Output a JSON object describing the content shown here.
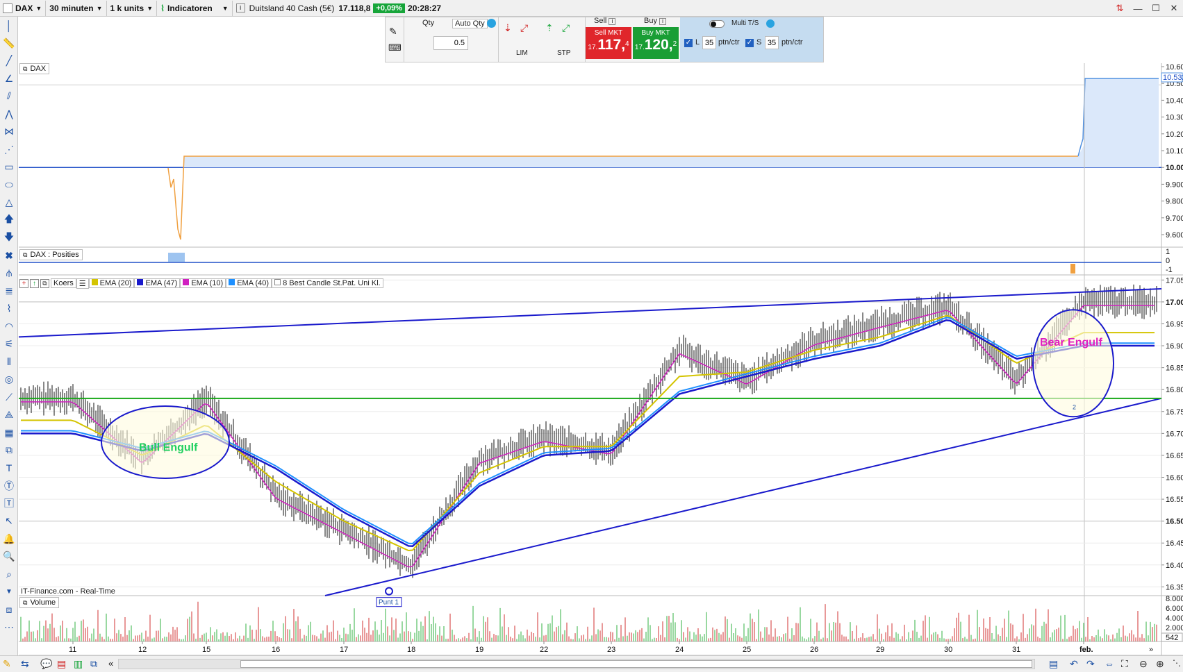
{
  "topbar": {
    "instrument": "DAX",
    "timeframe": "30 minuten",
    "units": "1 k units",
    "indicators_label": "Indicatoren",
    "market_name": "Duitsland 40 Cash (5€)",
    "price": "17.118,8",
    "change": "+0,09%",
    "time": "20:28:27"
  },
  "ticket": {
    "qty_label": "Qty",
    "qty_value": "0.5",
    "auto_qty_label": "Auto Qty",
    "lim_label": "LIM",
    "stp_label": "STP",
    "sell_label": "Sell",
    "buy_label": "Buy",
    "sell_mkt_label": "Sell MKT",
    "buy_mkt_label": "Buy MKT",
    "sell_price_prefix": "17.",
    "sell_price_main": "117,",
    "sell_price_suffix": "4",
    "buy_price_prefix": "17.",
    "buy_price_main": "120,",
    "buy_price_suffix": "2",
    "multi_ts_label": "Multi T/S",
    "l_label": "L",
    "l_value": "35",
    "l_unit": "ptn/ctr",
    "s_label": "S",
    "s_value": "35",
    "s_unit": "ptn/ctr",
    "colors": {
      "sell": "#e0262b",
      "buy": "#1a9e35",
      "blue_panel": "#c5dcf0"
    }
  },
  "panels": {
    "equity_label": "DAX",
    "positions_label": "DAX : Posities",
    "price_legend": {
      "koers": "Koers",
      "ema20": "EMA (20)",
      "ema47": "EMA (47)",
      "ema10": "EMA (10)",
      "ema40": "EMA (40)",
      "pattern": "8 Best Candle St.Pat. Uni Kl."
    },
    "volume_label": "Volume",
    "source": "IT-Finance.com - Real-Time",
    "pattern_bull": "Bull Engulf",
    "pattern_bear": "Bear Engulf",
    "point_label": "Punt 1",
    "bear_count": "2"
  },
  "axes": {
    "equity": [
      "10.600",
      "10.500",
      "10.400",
      "10.300",
      "10.200",
      "10.100",
      "10.000",
      "9.900",
      "9.800",
      "9.700",
      "9.600"
    ],
    "equity_marker": "10.532",
    "positions": [
      "1",
      "0",
      "-1"
    ],
    "price": [
      "17.050",
      "17.000",
      "16.950",
      "16.900",
      "16.850",
      "16.800",
      "16.750",
      "16.700",
      "16.650",
      "16.600",
      "16.550",
      "16.500",
      "16.450",
      "16.400",
      "16.350"
    ],
    "volume": [
      "8.000",
      "6.000",
      "4.000",
      "2.000"
    ],
    "volume_marker": "542",
    "dates": [
      "11",
      "12",
      "15",
      "16",
      "17",
      "18",
      "19",
      "22",
      "23",
      "24",
      "25",
      "26",
      "29",
      "30",
      "31",
      "feb."
    ]
  },
  "chart_data": {
    "type": "line",
    "title": "DAX",
    "xlabel": "",
    "ylabel": "",
    "categories": [
      "11",
      "12",
      "15",
      "16",
      "17",
      "18",
      "19",
      "22",
      "23",
      "24",
      "25",
      "26",
      "29",
      "30",
      "31",
      "feb."
    ],
    "ylim": [
      16330,
      17060
    ],
    "series": [
      {
        "name": "Koers",
        "values": [
          16780,
          16640,
          16780,
          16560,
          16480,
          16400,
          16640,
          16690,
          16660,
          16890,
          16820,
          16910,
          16950,
          16990,
          16820,
          17000
        ]
      },
      {
        "name": "EMA (20)",
        "values": [
          16730,
          16650,
          16720,
          16590,
          16500,
          16430,
          16610,
          16670,
          16670,
          16830,
          16840,
          16890,
          16920,
          16970,
          16860,
          16930
        ]
      },
      {
        "name": "EMA (47)",
        "values": [
          16700,
          16660,
          16700,
          16620,
          16520,
          16440,
          16580,
          16650,
          16660,
          16790,
          16830,
          16870,
          16900,
          16960,
          16870,
          16900
        ]
      }
    ],
    "colors": {
      "koers": "#111111",
      "ema20": "#d4c400",
      "ema47": "#1a1acc",
      "ema10": "#d020c0",
      "ema40": "#1e90ff",
      "trend": "#1a1acc",
      "support": "#18a818"
    }
  }
}
